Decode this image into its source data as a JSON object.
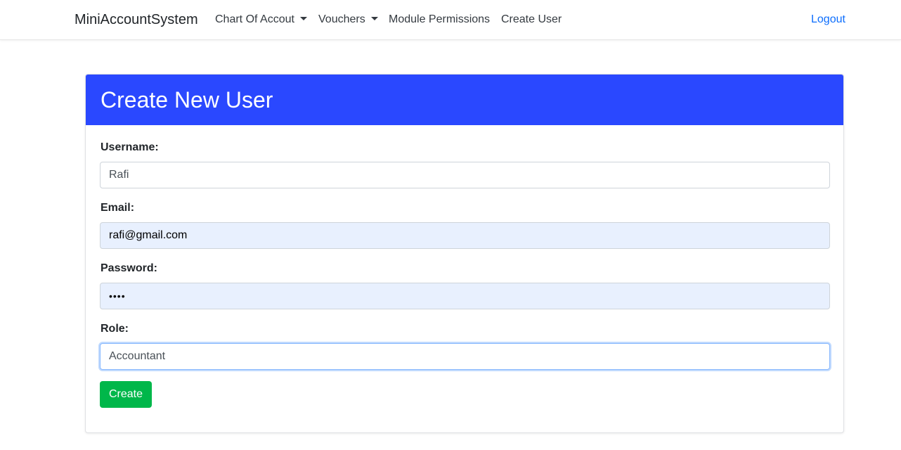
{
  "navbar": {
    "brand": "MiniAccountSystem",
    "items": [
      {
        "label": "Chart Of Accout",
        "dropdown": true
      },
      {
        "label": "Vouchers",
        "dropdown": true
      },
      {
        "label": "Module Permissions",
        "dropdown": false
      },
      {
        "label": "Create User",
        "dropdown": false
      }
    ],
    "logout": "Logout"
  },
  "form": {
    "title": "Create New User",
    "username": {
      "label": "Username:",
      "value": "Rafi"
    },
    "email": {
      "label": "Email:",
      "value": "rafi@gmail.com"
    },
    "password": {
      "label": "Password:",
      "value": "••••"
    },
    "role": {
      "label": "Role:",
      "value": "Accountant"
    },
    "submit_label": "Create"
  },
  "colors": {
    "header_bg": "#2a48ff",
    "create_button": "#00b74a",
    "link": "#0d6efd",
    "autofill_bg": "#e8f0fe"
  }
}
